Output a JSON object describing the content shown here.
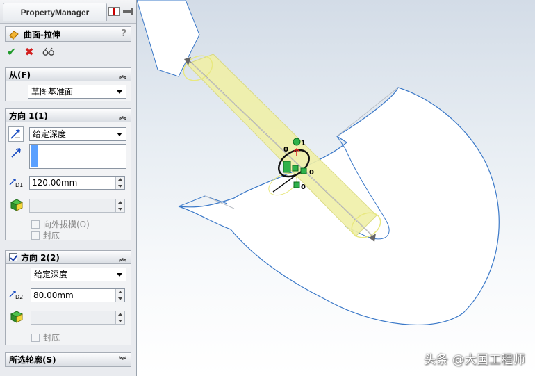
{
  "property_manager": {
    "tab_label": "PropertyManager",
    "feature_title": "曲面-拉伸",
    "help": "?",
    "actions": {
      "ok": "✔",
      "cancel": "✖",
      "detail": "&"
    },
    "from_group": {
      "title": "从(F)",
      "start_condition": "草图基准面"
    },
    "direction1": {
      "title": "方向 1(1)",
      "end_condition": "给定深度",
      "depth_label": "D1",
      "depth": "120.00mm"
    },
    "direction2": {
      "title": "方向 2(2)",
      "checked": true,
      "end_condition": "给定深度",
      "depth_label": "D2",
      "depth": "80.00mm"
    },
    "draft_outward": "向外拔模(O)",
    "cap_end_1": "封底",
    "cap_end_2": "封底",
    "selected_contours": {
      "title": "所选轮廓(S)"
    }
  },
  "viewport": {
    "handle_labels": [
      "1",
      "0",
      "0",
      "0"
    ],
    "watermark": "头条 @大国工程师",
    "colors": {
      "preview": "#f0f0a8",
      "edge": "#3a78c8",
      "handle": "#2fb24a"
    }
  }
}
